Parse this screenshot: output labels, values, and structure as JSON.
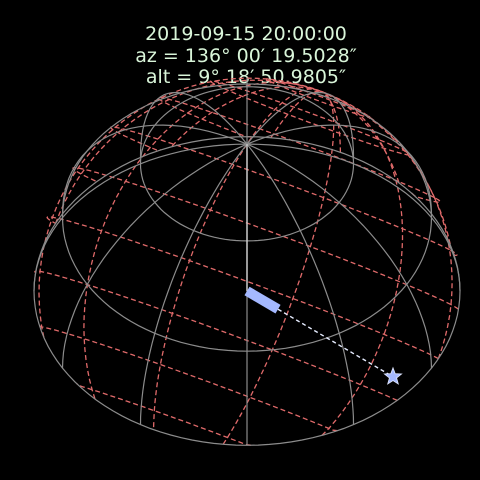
{
  "header": {
    "datetime": "2019-09-15 20:00:00",
    "azimuth": "az = 136° 00′ 19.5028″",
    "altitude": "alt = 9° 18′ 50.9805″"
  },
  "target": {
    "azimuth_deg": 136.0054,
    "altitude_deg": 9.3142
  },
  "colors": {
    "background": "#000000",
    "text": "#d9f5d9",
    "horizontal_grid": "#8c8c8c",
    "equatorial_grid": "#e06a6a",
    "pointer": "#a4b8ff",
    "star": "#a4b8ff"
  },
  "icons": {
    "target_marker": "star-icon"
  }
}
